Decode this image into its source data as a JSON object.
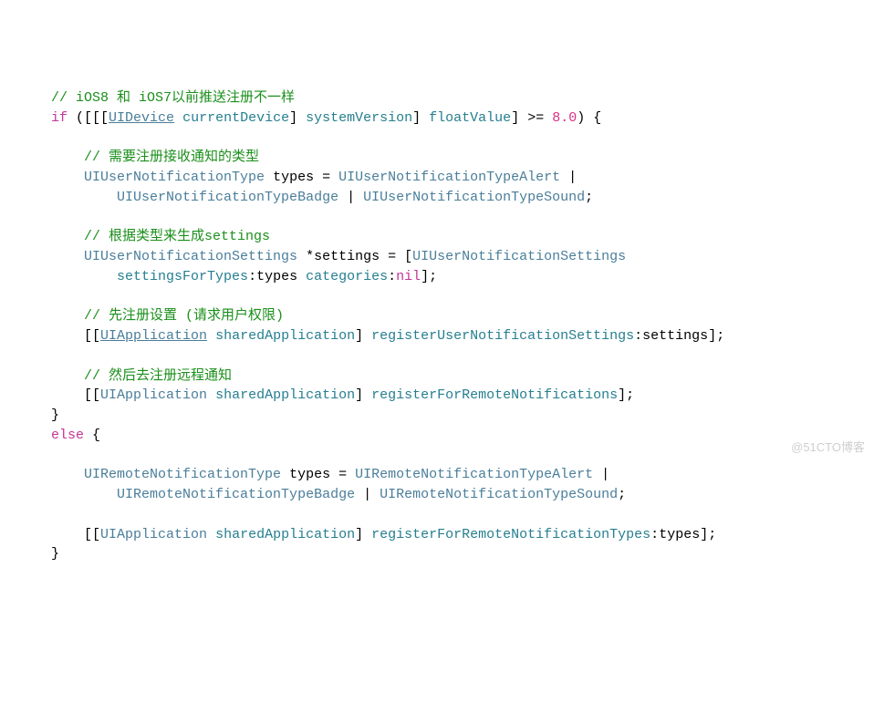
{
  "c1": "// iOS8 和 iOS7以前推送注册不一样",
  "kw_if": "if",
  "cls_UIDevice": "UIDevice",
  "m_currentDevice": "currentDevice",
  "m_systemVersion": "systemVersion",
  "m_floatValue": "floatValue",
  "num_8": "8.0",
  "c2": "// 需要注册接收通知的类型",
  "cls_UIUserNotificationType": "UIUserNotificationType",
  "v_types": "types",
  "cls_AlertType": "UIUserNotificationTypeAlert",
  "cls_BadgeType": "UIUserNotificationTypeBadge",
  "cls_SoundType": "UIUserNotificationTypeSound",
  "c3": "// 根据类型来生成settings",
  "cls_UIUserNotificationSettings": "UIUserNotificationSettings",
  "v_settings": "settings",
  "m_settingsForTypes": "settingsForTypes",
  "m_categories": "categories",
  "kw_nil": "nil",
  "c4": "// 先注册设置 (请求用户权限)",
  "cls_UIApplication": "UIApplication",
  "m_sharedApplication": "sharedApplication",
  "m_registerUserNotificationSettings": "registerUserNotificationSettings",
  "c5": "// 然后去注册远程通知",
  "m_registerForRemoteNotifications": "registerForRemoteNotifications",
  "kw_else": "else",
  "cls_UIRemoteNotificationType": "UIRemoteNotificationType",
  "cls_RAlertType": "UIRemoteNotificationTypeAlert",
  "cls_RBadgeType": "UIRemoteNotificationTypeBadge",
  "cls_RSoundType": "UIRemoteNotificationTypeSound",
  "m_registerForRemoteNotificationTypes": "registerForRemoteNotificationTypes",
  "watermark": "@51CTO博客"
}
